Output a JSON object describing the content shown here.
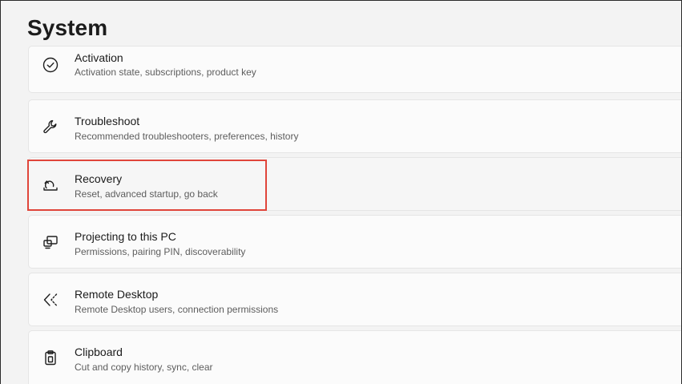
{
  "page": {
    "title": "System"
  },
  "settings": [
    {
      "title": "Activation",
      "subtitle": "Activation state, subscriptions, product key",
      "icon": "check-circle-icon"
    },
    {
      "title": "Troubleshoot",
      "subtitle": "Recommended troubleshooters, preferences, history",
      "icon": "wrench-icon"
    },
    {
      "title": "Recovery",
      "subtitle": "Reset, advanced startup, go back",
      "icon": "recovery-icon"
    },
    {
      "title": "Projecting to this PC",
      "subtitle": "Permissions, pairing PIN, discoverability",
      "icon": "projecting-icon"
    },
    {
      "title": "Remote Desktop",
      "subtitle": "Remote Desktop users, connection permissions",
      "icon": "remote-desktop-icon"
    },
    {
      "title": "Clipboard",
      "subtitle": "Cut and copy history, sync, clear",
      "icon": "clipboard-icon"
    }
  ],
  "highlight": {
    "color": "#e0453a",
    "target": "Recovery"
  }
}
